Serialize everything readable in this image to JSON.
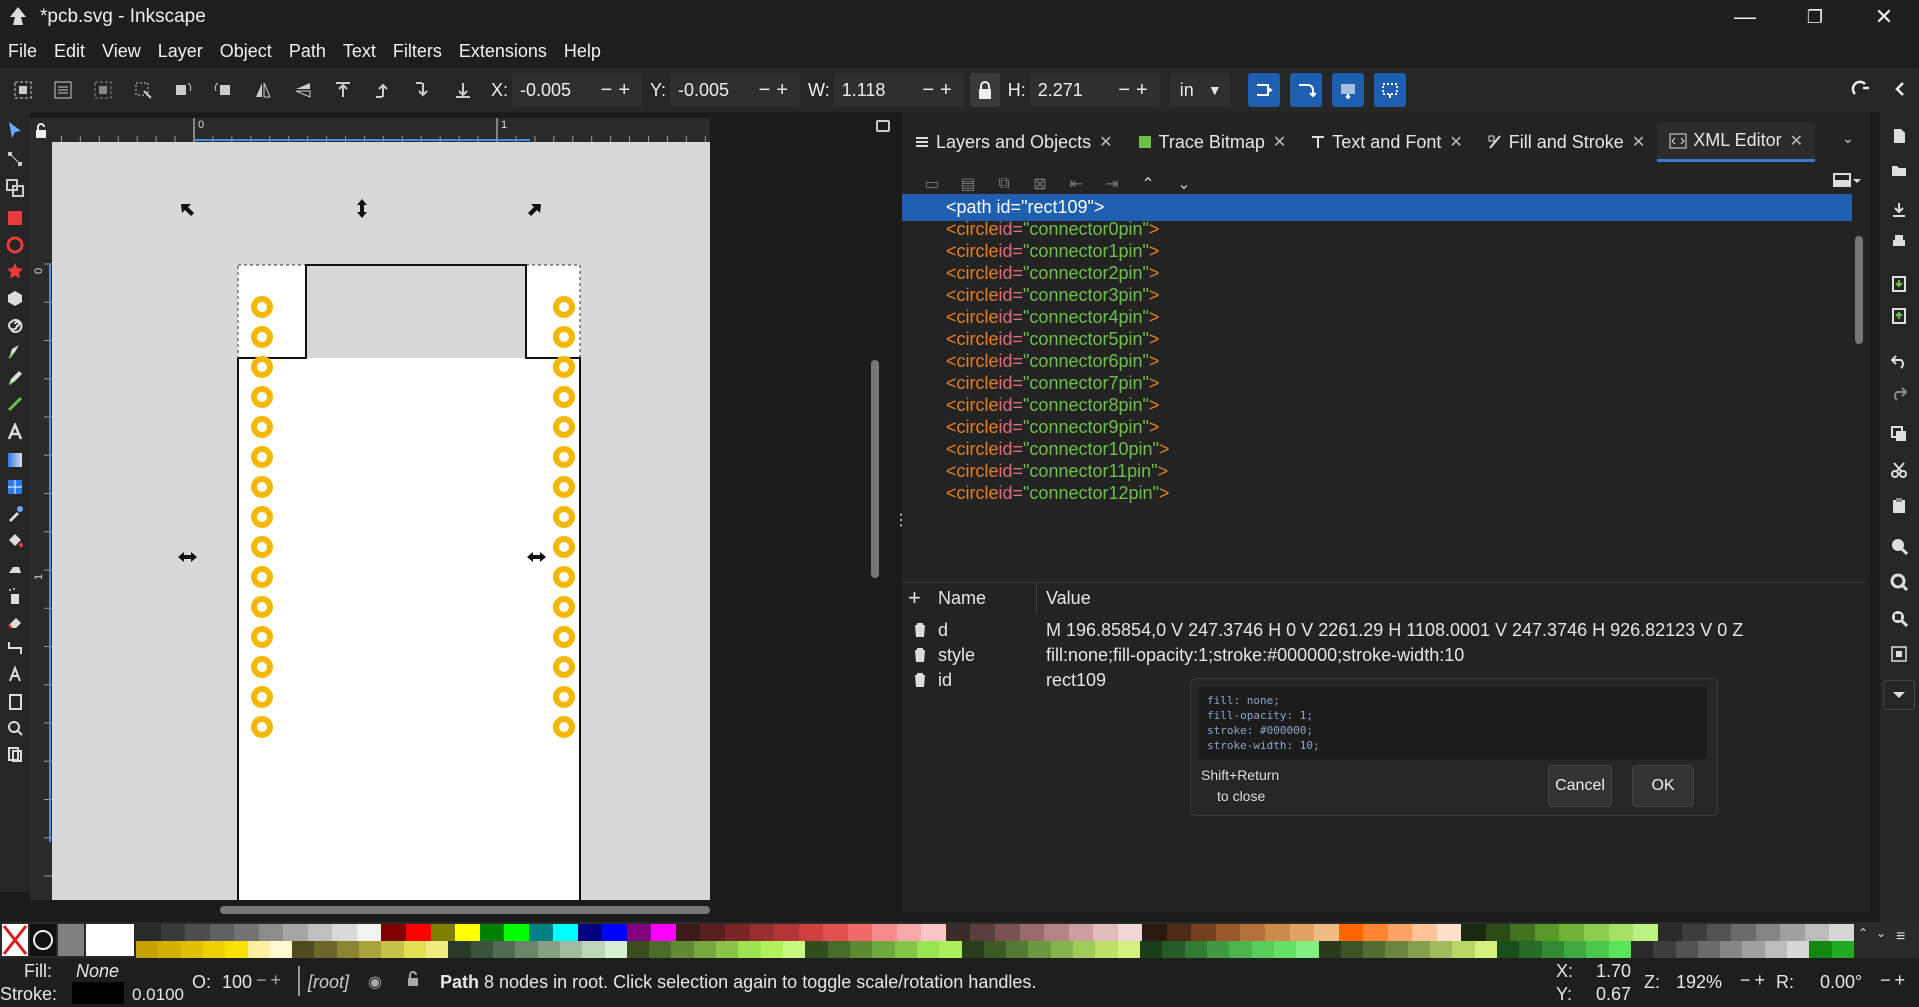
{
  "window": {
    "title": "*pcb.svg - Inkscape",
    "minimize": "—",
    "maximize": "❐",
    "close": "✕"
  },
  "menu": [
    "File",
    "Edit",
    "View",
    "Layer",
    "Object",
    "Path",
    "Text",
    "Filters",
    "Extensions",
    "Help"
  ],
  "toolbar": {
    "x_label": "X:",
    "x_value": "-0.005",
    "y_label": "Y:",
    "y_value": "-0.005",
    "w_label": "W:",
    "w_value": "1.118",
    "h_label": "H:",
    "h_value": "2.271",
    "unit": "in",
    "stepper": "−+"
  },
  "ruler": {
    "tick0": "0",
    "tick1": "1"
  },
  "tabs": [
    {
      "label": "Layers and Objects",
      "close": "✕"
    },
    {
      "label": "Trace Bitmap",
      "close": "✕"
    },
    {
      "label": "Text and Font",
      "close": "✕"
    },
    {
      "label": "Fill and Stroke",
      "close": "✕"
    },
    {
      "label": "XML Editor",
      "close": "✕"
    }
  ],
  "xml": {
    "selected_node": "<path id=\"rect109\">",
    "nodes": [
      {
        "tag": "<circle",
        "attr": " id=",
        "val": "\"connector0pin\"",
        "end": ">"
      },
      {
        "tag": "<circle",
        "attr": " id=",
        "val": "\"connector1pin\"",
        "end": ">"
      },
      {
        "tag": "<circle",
        "attr": " id=",
        "val": "\"connector2pin\"",
        "end": ">"
      },
      {
        "tag": "<circle",
        "attr": " id=",
        "val": "\"connector3pin\"",
        "end": ">"
      },
      {
        "tag": "<circle",
        "attr": " id=",
        "val": "\"connector4pin\"",
        "end": ">"
      },
      {
        "tag": "<circle",
        "attr": " id=",
        "val": "\"connector5pin\"",
        "end": ">"
      },
      {
        "tag": "<circle",
        "attr": " id=",
        "val": "\"connector6pin\"",
        "end": ">"
      },
      {
        "tag": "<circle",
        "attr": " id=",
        "val": "\"connector7pin\"",
        "end": ">"
      },
      {
        "tag": "<circle",
        "attr": " id=",
        "val": "\"connector8pin\"",
        "end": ">"
      },
      {
        "tag": "<circle",
        "attr": " id=",
        "val": "\"connector9pin\"",
        "end": ">"
      },
      {
        "tag": "<circle",
        "attr": " id=",
        "val": "\"connector10pin\"",
        "end": ">"
      },
      {
        "tag": "<circle",
        "attr": " id=",
        "val": "\"connector11pin\"",
        "end": ">"
      },
      {
        "tag": "<circle",
        "attr": " id=",
        "val": "\"connector12pin\"",
        "end": ">"
      }
    ],
    "attr_header": {
      "add": "+",
      "name": "Name",
      "value": "Value"
    },
    "attributes": [
      {
        "name": "d",
        "value": "M 196.85854,0 V 247.3746 H 0 V 2261.29 H 1108.0001 V 247.3746 H 926.82123 V 0 Z"
      },
      {
        "name": "style",
        "value": "fill:none;fill-opacity:1;stroke:#000000;stroke-width:10"
      },
      {
        "name": "id",
        "value": "rect109"
      }
    ],
    "popup": {
      "code": "fill: none;\nfill-opacity: 1;\nstroke: #000000;\nstroke-width: 10;",
      "hint_line1": "Shift+Return",
      "hint_line2": "to close",
      "cancel": "Cancel",
      "ok": "OK"
    }
  },
  "status": {
    "fill_label": "Fill:",
    "fill_value": "None",
    "stroke_label": "Stroke:",
    "stroke_width": "0.0100",
    "opacity_label": "O:",
    "opacity_value": "100",
    "layer": "[root]",
    "message_bold": "Path",
    "message": " 8 nodes in root. Click selection again to toggle scale/rotation handles.",
    "cursor_x_label": "X:",
    "cursor_x": "1.70",
    "cursor_y_label": "Y:",
    "cursor_y": "0.67",
    "zoom_label": "Z:",
    "zoom": "192%",
    "rotate_label": "R:",
    "rotate": "0.00°"
  },
  "colors": {
    "accent": "#1f5fb0",
    "pin": "#f5b800",
    "tag": "#e67e22",
    "attr": "#e06c75",
    "value": "#6cc04a"
  }
}
